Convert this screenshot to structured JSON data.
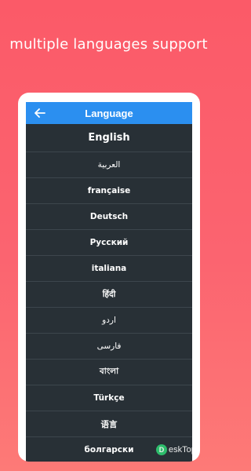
{
  "headline": "multiple languages support",
  "appbar": {
    "title": "Language",
    "back_icon": "arrow-left-icon"
  },
  "languages": [
    "English",
    "العربية",
    "française",
    "Deutsch",
    "Русский",
    "italiana",
    "हिंदी",
    "اردو",
    "فارسی",
    "বাংলা",
    "Türkçe",
    "语言",
    "болгарски"
  ],
  "selected_language": "English",
  "watermark": {
    "text": "eskTop",
    "icon": "D"
  },
  "colors": {
    "accent": "#2b8ff0",
    "background_top": "#fb5a68",
    "list_bg": "#283036"
  }
}
